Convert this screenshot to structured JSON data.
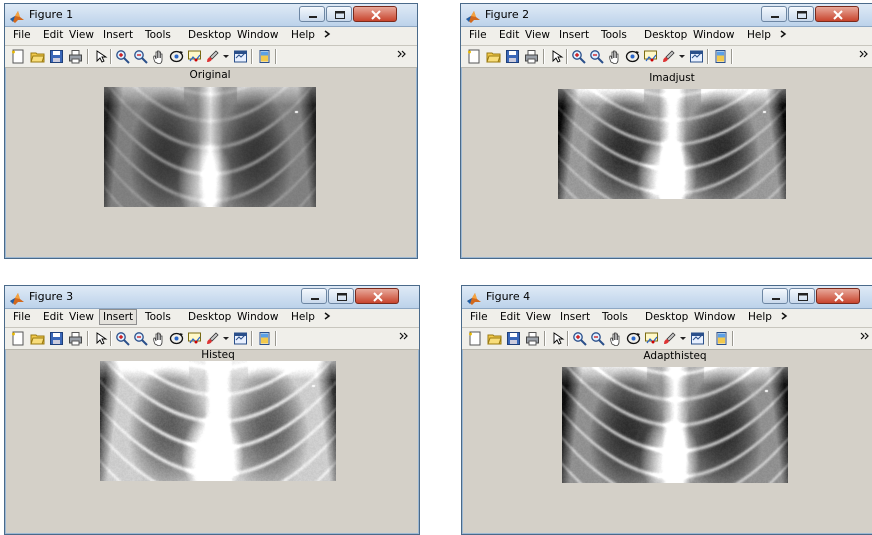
{
  "menus": [
    "File",
    "Edit",
    "View",
    "Insert",
    "Tools",
    "Desktop",
    "Window",
    "Help"
  ],
  "menu_overflow_icon": "chevron-right-icon",
  "toolbar_overflow_icon": "double-chevron-icon",
  "toolbar_icons": [
    "new-figure-icon",
    "open-folder-icon",
    "save-icon",
    "print-icon",
    "arrow-pointer-icon",
    "zoom-in-icon",
    "zoom-out-icon",
    "pan-hand-icon",
    "rotate-3d-icon",
    "data-cursor-icon",
    "brush-icon",
    "brush-dropdown-icon",
    "link-plot-icon",
    "colorbar-icon"
  ],
  "figures": [
    {
      "title": "Figure 1",
      "axes_title": "Original",
      "pressed_menu": "",
      "enhancement": "none"
    },
    {
      "title": "Figure 2",
      "axes_title": "Imadjust",
      "pressed_menu": "",
      "enhancement": "contrast-stretch"
    },
    {
      "title": "Figure 3",
      "axes_title": "Histeq",
      "pressed_menu": "Insert",
      "enhancement": "histogram-equalized"
    },
    {
      "title": "Figure 4",
      "axes_title": "Adapthisteq",
      "pressed_menu": "",
      "enhancement": "adaptive-equalized"
    }
  ],
  "colors": {
    "figure_bg": "#d4d0c8",
    "titlebar": "#cddcee",
    "close_button": "#c8442d"
  }
}
